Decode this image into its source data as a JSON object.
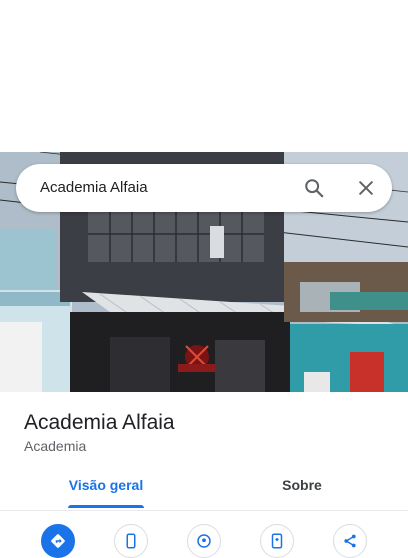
{
  "search": {
    "query": "Academia Alfaia",
    "search_icon": "search-icon",
    "close_icon": "close-icon"
  },
  "place": {
    "name": "Academia Alfaia",
    "category": "Academia"
  },
  "tabs": [
    {
      "label": "Visão geral",
      "selected": true
    },
    {
      "label": "Sobre",
      "selected": false
    }
  ],
  "actions": [
    {
      "icon": "directions-icon",
      "primary": true
    },
    {
      "icon": "phone-icon",
      "primary": false
    },
    {
      "icon": "location-icon",
      "primary": false
    },
    {
      "icon": "save-icon",
      "primary": false
    },
    {
      "icon": "share-icon",
      "primary": false
    }
  ],
  "colors": {
    "accent": "#1a73e8",
    "text_primary": "#202124",
    "text_secondary": "#5f6368"
  }
}
